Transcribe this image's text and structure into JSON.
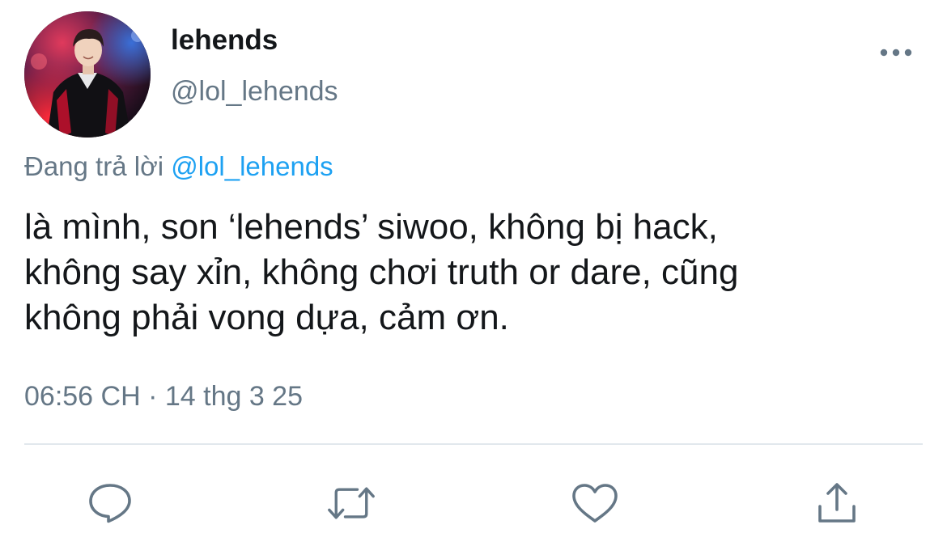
{
  "author": {
    "display_name": "lehends",
    "handle": "@lol_lehends",
    "avatar_icon": "profile-photo"
  },
  "reply_context": {
    "prefix": "Đang trả lời ",
    "mention": "@lol_lehends"
  },
  "tweet": {
    "text": "là mình, son ‘lehends’ siwoo, không bị hack,\nkhông say xỉn, không chơi truth or dare, cũng\nkhông phải vong dựa, cảm ơn.",
    "timestamp": "06:56 CH · 14 thg 3 25"
  },
  "actions": [
    {
      "name": "reply",
      "icon": "speech-bubble-icon"
    },
    {
      "name": "retweet",
      "icon": "retweet-arrows-icon"
    },
    {
      "name": "like",
      "icon": "heart-icon"
    },
    {
      "name": "share",
      "icon": "share-upload-icon"
    }
  ],
  "colors": {
    "text": "#14171a",
    "secondary": "#657786",
    "link": "#1da1f2",
    "divider": "#e1e8ed",
    "icon": "#657786"
  }
}
